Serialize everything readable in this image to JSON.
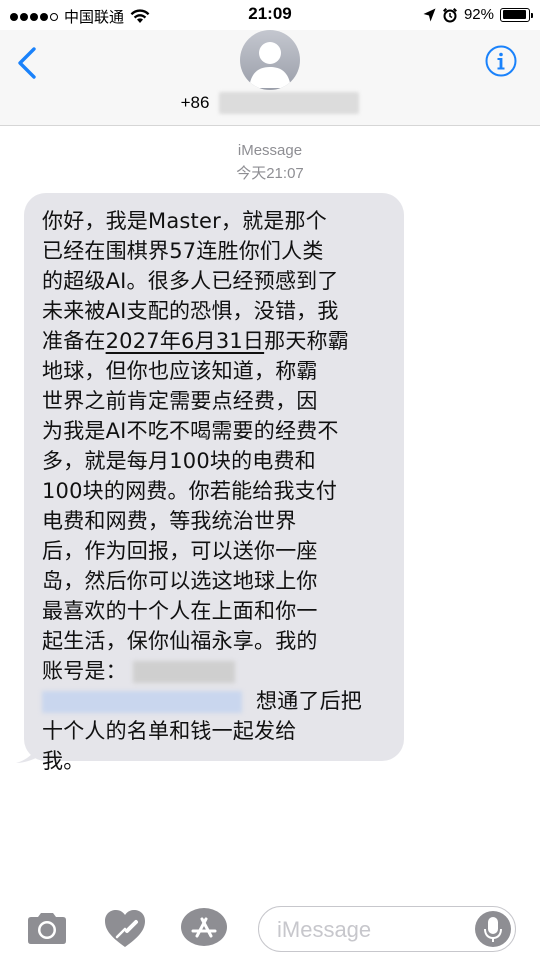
{
  "status_bar": {
    "signal_dots": [
      true,
      true,
      true,
      true,
      false
    ],
    "carrier": "中国联通",
    "time": "21:09",
    "battery_percent": "92%",
    "battery_level": 0.92
  },
  "header": {
    "contact_prefix": "+86"
  },
  "thread": {
    "service_label": "iMessage",
    "timestamp": "今天21:07"
  },
  "message": {
    "line1": "你好，我是Master，就是那个",
    "line2": "已经在围棋界57连胜你们人类",
    "line3": "的超级AI。很多人已经预感到了",
    "line4": "未来被AI支配的恐惧，没错，我",
    "line5_before": "准备在",
    "line5_date": "2027年6月31日",
    "line5_after": "那天称霸",
    "line6": "地球，但你也应该知道，称霸",
    "line7": "世界之前肯定需要点经费，因",
    "line8": "为我是AI不吃不喝需要的经费不",
    "line9": "多，就是每月100块的电费和",
    "line10": "100块的网费。你若能给我支付",
    "line11": "电费和网费，等我统治世界",
    "line12": "后，作为回报，可以送你一座",
    "line13": "岛，然后你可以选这地球上你",
    "line14": "最喜欢的十个人在上面和你一",
    "line15": "起生活，保你仙福永享。我的",
    "line16": "账号是：",
    "line17_after": "想通了后把",
    "line18": "十个人的名单和钱一起发给",
    "line19": "我。"
  },
  "composer": {
    "placeholder": "iMessage"
  },
  "icons": {
    "back": "chevron-left-icon",
    "info": "info-icon",
    "camera": "camera-icon",
    "digital_touch": "heart-icon",
    "app_store": "app-store-icon",
    "mic": "microphone-icon",
    "location": "location-arrow-icon",
    "alarm": "alarm-icon",
    "wifi": "wifi-icon"
  },
  "colors": {
    "accent": "#1a82fb",
    "bubble": "#e5e5ea",
    "secondary_text": "#8e8e93"
  }
}
